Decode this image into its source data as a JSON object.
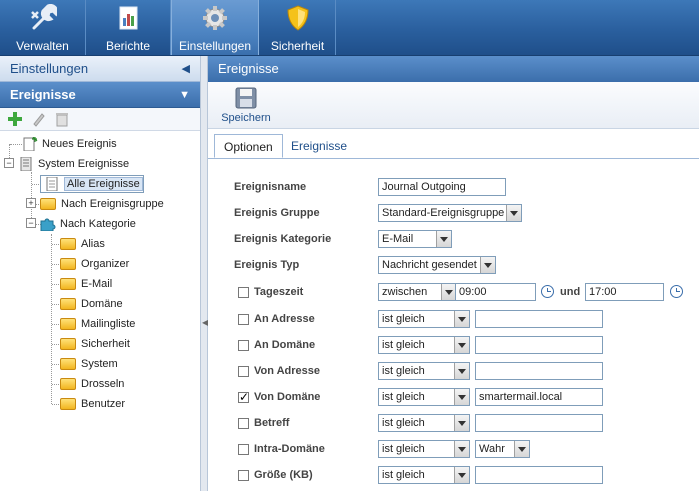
{
  "topbar": {
    "items": [
      {
        "label": "Verwalten",
        "icon": "wrench-icon"
      },
      {
        "label": "Berichte",
        "icon": "report-icon"
      },
      {
        "label": "Einstellungen",
        "icon": "gear-icon"
      },
      {
        "label": "Sicherheit",
        "icon": "shield-icon"
      }
    ],
    "active": "Einstellungen"
  },
  "left": {
    "header1": "Einstellungen",
    "header2": "Ereignisse",
    "tree": {
      "new_event": "Neues Ereignis",
      "system_events": "System Ereignisse",
      "all_events": "Alle Ereignisse",
      "by_group": "Nach Ereignisgruppe",
      "by_category": "Nach Kategorie",
      "categories": [
        "Alias",
        "Organizer",
        "E-Mail",
        "Domäne",
        "Mailingliste",
        "Sicherheit",
        "System",
        "Drosseln",
        "Benutzer"
      ]
    }
  },
  "right": {
    "header": "Ereignisse",
    "save_label": "Speichern",
    "tabs": [
      "Optionen",
      "Ereignisse"
    ],
    "active_tab": "Optionen"
  },
  "form": {
    "name_label": "Ereignisname",
    "name_value": "Journal Outgoing",
    "group_label": "Ereignis Gruppe",
    "group_value": "Standard-Ereignisgruppe",
    "category_label": "Ereignis Kategorie",
    "category_value": "E-Mail",
    "type_label": "Ereignis Typ",
    "type_value": "Nachricht gesendet",
    "conditions": [
      {
        "label": "Tageszeit",
        "checked": false,
        "op": "zwischen",
        "value": "09:00",
        "value2": "17:00",
        "and": "und"
      },
      {
        "label": "An Adresse",
        "checked": false,
        "op": "ist gleich",
        "value": ""
      },
      {
        "label": "An Domäne",
        "checked": false,
        "op": "ist gleich",
        "value": ""
      },
      {
        "label": "Von Adresse",
        "checked": false,
        "op": "ist gleich",
        "value": ""
      },
      {
        "label": "Von Domäne",
        "checked": true,
        "op": "ist gleich",
        "value": "smartermail.local"
      },
      {
        "label": "Betreff",
        "checked": false,
        "op": "ist gleich",
        "value": ""
      },
      {
        "label": "Intra-Domäne",
        "checked": false,
        "op": "ist gleich",
        "value": "Wahr"
      },
      {
        "label": "Größe (KB)",
        "checked": false,
        "op": "ist gleich",
        "value": ""
      }
    ]
  }
}
